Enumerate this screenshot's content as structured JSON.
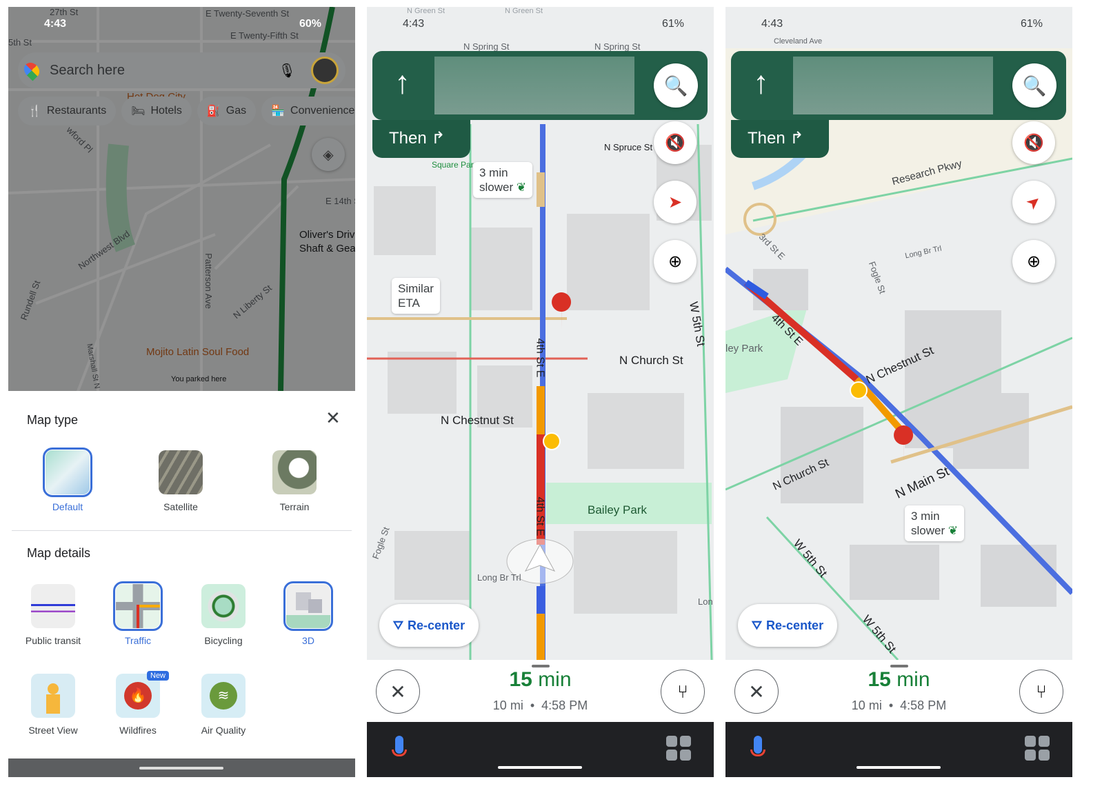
{
  "screen1": {
    "status": {
      "time": "4:43",
      "battery": "60%"
    },
    "map_labels": [
      "27th St",
      "E Twenty-Seventh St",
      "E Twenty-Fifth St",
      "5th St",
      "Patters",
      "Hot Dog City",
      "wford Pl",
      "E 14th St",
      "Oliver's Driv",
      "Shaft & Gea",
      "Northwest Blvd",
      "Rundell St",
      "Patterson Ave",
      "N Liberty St",
      "Mojito Latin Soul Food",
      "You parked here",
      "Marshall St N",
      "St"
    ],
    "search": {
      "placeholder": "Search here"
    },
    "chips": [
      "Restaurants",
      "Hotels",
      "Gas",
      "Convenience"
    ],
    "sheet": {
      "map_type_title": "Map type",
      "map_types": [
        {
          "label": "Default",
          "selected": true
        },
        {
          "label": "Satellite",
          "selected": false
        },
        {
          "label": "Terrain",
          "selected": false
        }
      ],
      "map_details_title": "Map details",
      "details": [
        {
          "label": "Public transit",
          "selected": false
        },
        {
          "label": "Traffic",
          "selected": true
        },
        {
          "label": "Bicycling",
          "selected": false
        },
        {
          "label": "3D",
          "selected": true
        },
        {
          "label": "Street View",
          "selected": false
        },
        {
          "label": "Wildfires",
          "selected": false,
          "badge": "New"
        },
        {
          "label": "Air Quality",
          "selected": false
        }
      ]
    }
  },
  "screen2": {
    "status": {
      "time": "4:43",
      "battery": "61%"
    },
    "then_label": "Then",
    "map_labels": [
      "N Spring St",
      "N Spring St",
      "N Green St",
      "N Green St",
      "N Spruce St",
      "Square Par",
      "N Church St",
      "N Chestnut St",
      "4th St E",
      "4th St E",
      "W 5th St",
      "Bailey Park",
      "Fogle St",
      "Long Br Trl",
      "Lon",
      "W"
    ],
    "bubbles": [
      {
        "line1": "3 min",
        "line2": "slower"
      },
      {
        "line1": "Similar",
        "line2": "ETA"
      }
    ],
    "recenter": "Re-center",
    "eta": {
      "value": "15",
      "unit": "min",
      "distance": "10 mi",
      "arrival": "4:58 PM",
      "sep": "•"
    }
  },
  "screen3": {
    "status": {
      "time": "4:43",
      "battery": "61%"
    },
    "then_label": "Then",
    "map_labels": [
      "Research Pkwy",
      "3rd St E",
      "Fogle St",
      "Long Br Trl",
      "4th St E",
      "ley Park",
      "N Chestnut St",
      "N Church St",
      "N Main St",
      "W 5th St",
      "W 5th St",
      "St",
      "Cleveland Ave"
    ],
    "bubbles": [
      {
        "line1": "3 min",
        "line2": "slower"
      }
    ],
    "recenter": "Re-center",
    "eta": {
      "value": "15",
      "unit": "min",
      "distance": "10 mi",
      "arrival": "4:58 PM",
      "sep": "•"
    }
  },
  "colors": {
    "nav_green": "#235f49",
    "eta_green": "#188038",
    "selected_blue": "#3a6fd8",
    "recenter_blue": "#1a57c9",
    "traffic_red": "#d93025",
    "traffic_orange": "#f29900",
    "route_blue": "#4b6ee0"
  }
}
